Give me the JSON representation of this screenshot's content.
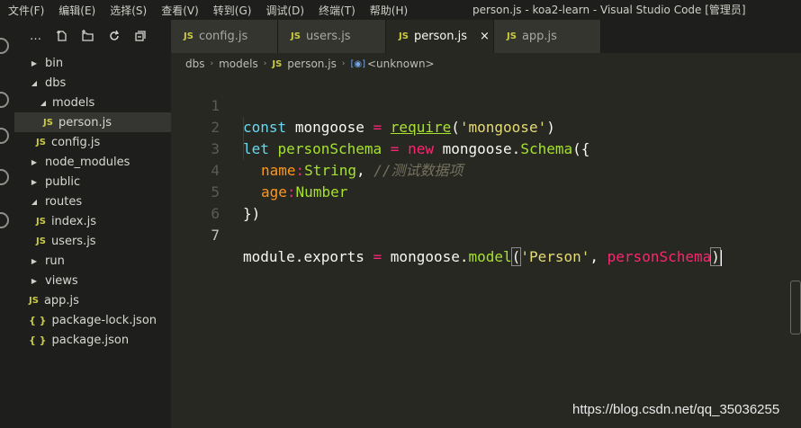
{
  "menu": {
    "items": [
      "文件(F)",
      "编辑(E)",
      "选择(S)",
      "查看(V)",
      "转到(G)",
      "调试(D)",
      "终端(T)",
      "帮助(H)"
    ],
    "window_title": "person.js - koa2-learn - Visual Studio Code [管理员]"
  },
  "sidebar": {
    "toolbar_icons": [
      "more-actions-icon",
      "new-file-icon",
      "new-folder-icon",
      "refresh-icon",
      "collapse-all-icon"
    ],
    "tree": [
      {
        "label": "bin",
        "kind": "folder",
        "expanded": false,
        "depth": 0
      },
      {
        "label": "dbs",
        "kind": "folder",
        "expanded": true,
        "depth": 0
      },
      {
        "label": "models",
        "kind": "folder",
        "expanded": true,
        "depth": 1
      },
      {
        "label": "person.js",
        "kind": "js",
        "depth": 2,
        "selected": true
      },
      {
        "label": "config.js",
        "kind": "js",
        "depth": 1
      },
      {
        "label": "node_modules",
        "kind": "folder",
        "expanded": false,
        "depth": 0
      },
      {
        "label": "public",
        "kind": "folder",
        "expanded": false,
        "depth": 0
      },
      {
        "label": "routes",
        "kind": "folder",
        "expanded": true,
        "depth": 0
      },
      {
        "label": "index.js",
        "kind": "js",
        "depth": 1
      },
      {
        "label": "users.js",
        "kind": "js",
        "depth": 1
      },
      {
        "label": "run",
        "kind": "folder",
        "expanded": false,
        "depth": 0
      },
      {
        "label": "views",
        "kind": "folder",
        "expanded": false,
        "depth": 0
      },
      {
        "label": "app.js",
        "kind": "js",
        "depth": 0
      },
      {
        "label": "package-lock.json",
        "kind": "json",
        "depth": 0
      },
      {
        "label": "package.json",
        "kind": "json",
        "depth": 0
      }
    ]
  },
  "tabs": [
    {
      "label": "config.js",
      "active": false
    },
    {
      "label": "users.js",
      "active": false
    },
    {
      "label": "person.js",
      "active": true
    },
    {
      "label": "app.js",
      "active": false
    }
  ],
  "badges": {
    "js": "JS",
    "json": "{ }"
  },
  "tab_close_glyph": "×",
  "breadcrumb": {
    "parts": [
      "dbs",
      "models",
      "person.js",
      "<unknown>"
    ],
    "separator": "›"
  },
  "editor": {
    "line_numbers": [
      "1",
      "2",
      "3",
      "4",
      "5",
      "6",
      "7"
    ]
  },
  "code": {
    "l1": {
      "kw": "const",
      "name": "mongoose",
      "eq": "=",
      "fn": "require",
      "open": "(",
      "str": "'mongoose'",
      "close": ")"
    },
    "l2": {
      "kw": "let",
      "name": "personSchema",
      "eq": "=",
      "newkw": "new",
      "obj": "mongoose",
      "dot": ".",
      "cls": "Schema",
      "open": "({"
    },
    "l3": {
      "prop": "name",
      "colon": ":",
      "type": "String",
      "comma": ",",
      "comment": "//测试数据项"
    },
    "l4": {
      "prop": "age",
      "colon": ":",
      "type": "Number"
    },
    "l5": {
      "close": "})"
    },
    "l7": {
      "obj": "module",
      "dot1": ".",
      "prop": "exports",
      "eq": "=",
      "obj2": "mongoose",
      "dot2": ".",
      "fn": "model",
      "open": "(",
      "str": "'Person'",
      "comma": ",",
      "arg": "personSchema",
      "close": ")"
    }
  },
  "watermark": "https://blog.csdn.net/qq_35036255"
}
